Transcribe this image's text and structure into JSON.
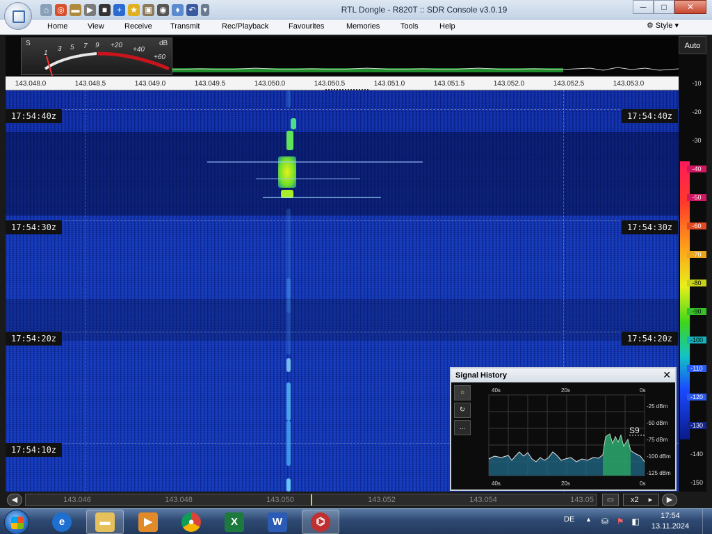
{
  "window": {
    "title": "RTL Dongle - R820T :: SDR Console v3.0.19",
    "minimize": "─",
    "maximize": "□",
    "close": "✕"
  },
  "menu": {
    "items": [
      "Home",
      "View",
      "Receive",
      "Transmit",
      "Rec/Playback",
      "Favourites",
      "Memories",
      "Tools",
      "Help"
    ],
    "style": "Style"
  },
  "smeter": {
    "s_label": "S",
    "db_label": "dB",
    "scale": [
      "1",
      "3",
      "5",
      "7",
      "9",
      "+20",
      "+40",
      "+60"
    ]
  },
  "auto_button": "Auto",
  "frequency_scale": [
    "143.048.0",
    "143.048.5",
    "143.049.0",
    "143.049.5",
    "143.050.0",
    "143.050.5",
    "143.051.0",
    "143.051.5",
    "143.052.0",
    "143.052.5",
    "143.053.0"
  ],
  "waterfall": {
    "time_labels": [
      "17:54:40z",
      "17:54:30z",
      "17:54:20z",
      "17:54:10z"
    ]
  },
  "color_scale": {
    "labels": [
      "-10",
      "-20",
      "-30",
      "-40",
      "-50",
      "-60",
      "-70",
      "-80",
      "-90",
      "-100",
      "-110",
      "-120",
      "-130",
      "-140",
      "-150"
    ]
  },
  "signal_history": {
    "title": "Signal History",
    "close": "✕",
    "tools": [
      "○",
      "↻",
      "..."
    ],
    "top_axis": [
      "40s",
      "20s",
      "0s"
    ],
    "bottom_axis": [
      "40s",
      "20s",
      "0s"
    ],
    "dbm_labels": [
      "-25 dBm",
      "-50 dBm",
      "-75 dBm",
      "-100 dBm",
      "-125 dBm"
    ],
    "marker": "S9"
  },
  "timeline": {
    "labels": [
      "143.046",
      "143.048",
      "143.050",
      "143.052",
      "143.054",
      "143.05"
    ],
    "zoom": "x2",
    "left_button": "◀",
    "right_button": "▶"
  },
  "taskbar": {
    "language": "DE",
    "time": "17:54",
    "date": "13.11.2024"
  },
  "colors": {
    "waterfall_bg": "#1237b5",
    "signal_green": "#6fe02a",
    "meter_red": "#c8141c"
  }
}
